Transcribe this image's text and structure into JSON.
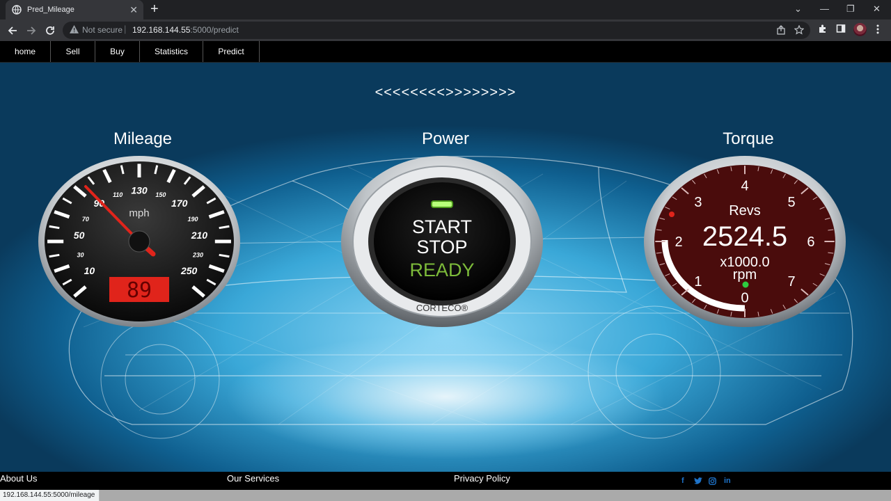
{
  "browser": {
    "tab_title": "Pred_Mileage",
    "security_label": "Not secure",
    "url_host": "192.168.144.55",
    "url_path": ":5000/predict",
    "status_url": "192.168.144.55:5000/mileage"
  },
  "nav": {
    "items": [
      "home",
      "Sell",
      "Buy",
      "Statistics",
      "Predict"
    ]
  },
  "hero": {
    "arrows": "<<<<<<<<>>>>>>>>"
  },
  "mileage": {
    "title": "Mileage",
    "unit": "mph",
    "big_labels": [
      "10",
      "50",
      "90",
      "130",
      "170",
      "210",
      "250"
    ],
    "small_labels": [
      "30",
      "70",
      "110",
      "150",
      "190",
      "230"
    ],
    "readout": "89",
    "accent": "#e0241b"
  },
  "power": {
    "title": "Power",
    "line1": "START",
    "line2": "STOP",
    "status": "READY",
    "brand": "CORTECO®",
    "status_color": "#7dbb3a"
  },
  "torque": {
    "title": "Torque",
    "label": "Revs",
    "value": "2524.5",
    "multiplier": "x1000.0",
    "unit": "rpm",
    "scale": [
      "0",
      "1",
      "2",
      "3",
      "4",
      "5",
      "6",
      "7"
    ],
    "face_color": "#4a0c0c",
    "indicator_color": "#2ecc40"
  },
  "footer": {
    "about": "About Us",
    "services": "Our Services",
    "privacy": "Privacy Policy",
    "social": [
      "f",
      "t",
      "ig",
      "in"
    ]
  }
}
